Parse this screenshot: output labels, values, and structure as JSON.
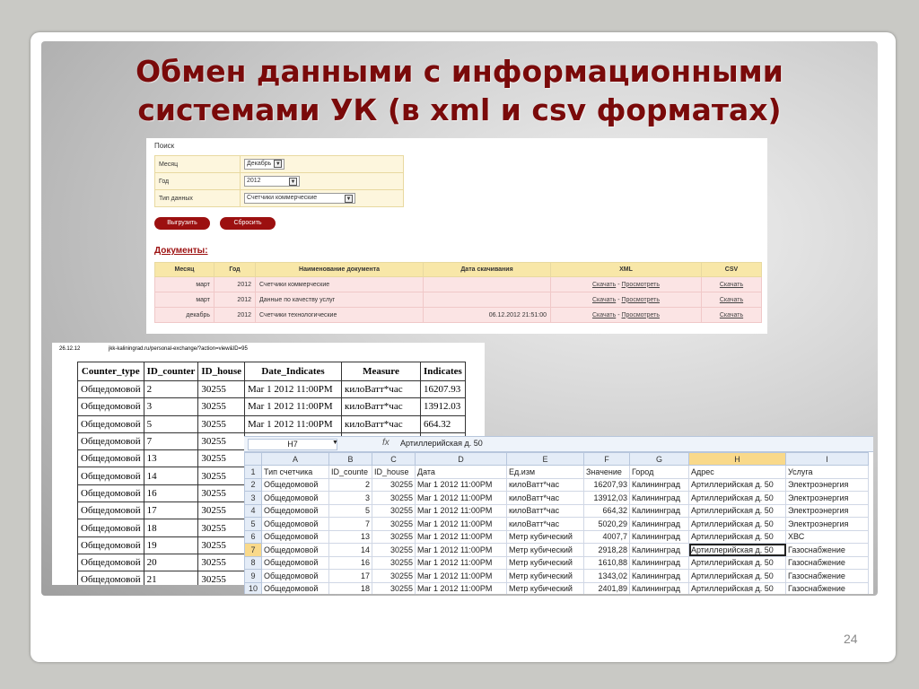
{
  "slide": {
    "title_line1": "Обмен данными с информационными",
    "title_line2": "системами УК (в xml и csv форматах)",
    "page_number": "24"
  },
  "web": {
    "search_title": "Поиск",
    "form": [
      {
        "label": "Месяц",
        "value": "Декабрь"
      },
      {
        "label": "Год",
        "value": "2012"
      },
      {
        "label": "Тип данных",
        "value": "Счетчики коммерческие"
      }
    ],
    "export_button": "Выгрузить",
    "reset_button": "Сбросить",
    "docs_title": "Документы:",
    "columns": [
      "Месяц",
      "Год",
      "Наименование документа",
      "Дата скачивания",
      "XML",
      "CSV"
    ],
    "rows": [
      {
        "month": "март",
        "year": "2012",
        "name": "Счетчики коммерческие",
        "date": "",
        "xml_download": "Скачать",
        "xml_view": "Просмотреть",
        "csv": "Скачать"
      },
      {
        "month": "март",
        "year": "2012",
        "name": "Данные по качеству услуг",
        "date": "",
        "xml_download": "Скачать",
        "xml_view": "Просмотреть",
        "csv": "Скачать"
      },
      {
        "month": "декабрь",
        "year": "2012",
        "name": "Счетчики технологические",
        "date": "06.12.2012 21:51:00",
        "xml_download": "Скачать",
        "xml_view": "Просмотреть",
        "csv": "Скачать"
      }
    ],
    "xml_separator": "-"
  },
  "report": {
    "date": "26.12.12",
    "url": "jkk-kaliningrad.ru/personal-exchange/?action=view&ID=95",
    "columns": [
      "Counter_type",
      "ID_counter",
      "ID_house",
      "Date_Indicates",
      "Measure",
      "Indicates"
    ],
    "rows": [
      [
        "Общедомовой",
        "2",
        "30255",
        "Mar 1 2012 11:00PM",
        "килоВатт*час",
        "16207.93"
      ],
      [
        "Общедомовой",
        "3",
        "30255",
        "Mar 1 2012 11:00PM",
        "килоВатт*час",
        "13912.03"
      ],
      [
        "Общедомовой",
        "5",
        "30255",
        "Mar 1 2012 11:00PM",
        "килоВатт*час",
        "664.32"
      ],
      [
        "Общедомовой",
        "7",
        "30255",
        "",
        "",
        ""
      ],
      [
        "Общедомовой",
        "13",
        "30255",
        "",
        "",
        ""
      ],
      [
        "Общедомовой",
        "14",
        "30255",
        "",
        "",
        ""
      ],
      [
        "Общедомовой",
        "16",
        "30255",
        "",
        "",
        ""
      ],
      [
        "Общедомовой",
        "17",
        "30255",
        "",
        "",
        ""
      ],
      [
        "Общедомовой",
        "18",
        "30255",
        "",
        "",
        ""
      ],
      [
        "Общедомовой",
        "19",
        "30255",
        "",
        "",
        ""
      ],
      [
        "Общедомовой",
        "20",
        "30255",
        "",
        "",
        ""
      ],
      [
        "Общедомовой",
        "21",
        "30255",
        "",
        "",
        ""
      ]
    ]
  },
  "excel": {
    "name_box": "H7",
    "fx": "fx",
    "formula": "Артиллерийская д. 50",
    "col_letters": [
      "A",
      "B",
      "C",
      "D",
      "E",
      "F",
      "G",
      "H",
      "I"
    ],
    "rows": [
      [
        "1",
        "Тип счетчика",
        "ID_counte",
        "ID_house",
        "Дата",
        "Ед.изм",
        "Значение",
        "Город",
        "Адрес",
        "Услуга"
      ],
      [
        "2",
        "Общедомовой",
        "2",
        "30255",
        "Mar 1 2012 11:00PM",
        "килоВатт*час",
        "16207,93",
        "Калининград",
        "Артиллерийская д. 50",
        "Электроэнергия"
      ],
      [
        "3",
        "Общедомовой",
        "3",
        "30255",
        "Mar 1 2012 11:00PM",
        "килоВатт*час",
        "13912,03",
        "Калининград",
        "Артиллерийская д. 50",
        "Электроэнергия"
      ],
      [
        "4",
        "Общедомовой",
        "5",
        "30255",
        "Mar 1 2012 11:00PM",
        "килоВатт*час",
        "664,32",
        "Калининград",
        "Артиллерийская д. 50",
        "Электроэнергия"
      ],
      [
        "5",
        "Общедомовой",
        "7",
        "30255",
        "Mar 1 2012 11:00PM",
        "килоВатт*час",
        "5020,29",
        "Калининград",
        "Артиллерийская д. 50",
        "Электроэнергия"
      ],
      [
        "6",
        "Общедомовой",
        "13",
        "30255",
        "Mar 1 2012 11:00PM",
        "Метр кубический",
        "4007,7",
        "Калининград",
        "Артиллерийская д. 50",
        "ХВС"
      ],
      [
        "7",
        "Общедомовой",
        "14",
        "30255",
        "Mar 1 2012 11:00PM",
        "Метр кубический",
        "2918,28",
        "Калининград",
        "Артиллерийская д. 50",
        "Газоснабжение"
      ],
      [
        "8",
        "Общедомовой",
        "16",
        "30255",
        "Mar 1 2012 11:00PM",
        "Метр кубический",
        "1610,88",
        "Калининград",
        "Артиллерийская д. 50",
        "Газоснабжение"
      ],
      [
        "9",
        "Общедомовой",
        "17",
        "30255",
        "Mar 1 2012 11:00PM",
        "Метр кубический",
        "1343,02",
        "Калининград",
        "Артиллерийская д. 50",
        "Газоснабжение"
      ],
      [
        "10",
        "Общедомовой",
        "18",
        "30255",
        "Mar 1 2012 11:00PM",
        "Метр кубический",
        "2401,89",
        "Калининград",
        "Артиллерийская д. 50",
        "Газоснабжение"
      ]
    ]
  },
  "colors": {
    "title": "#7a0a0a",
    "button": "#9c1010",
    "form_bg": "#fdf6dd",
    "table_header": "#f8e7a8",
    "table_row": "#fbe4e4",
    "excel_header": "#e4ecf7",
    "excel_selected": "#f9d98a"
  }
}
